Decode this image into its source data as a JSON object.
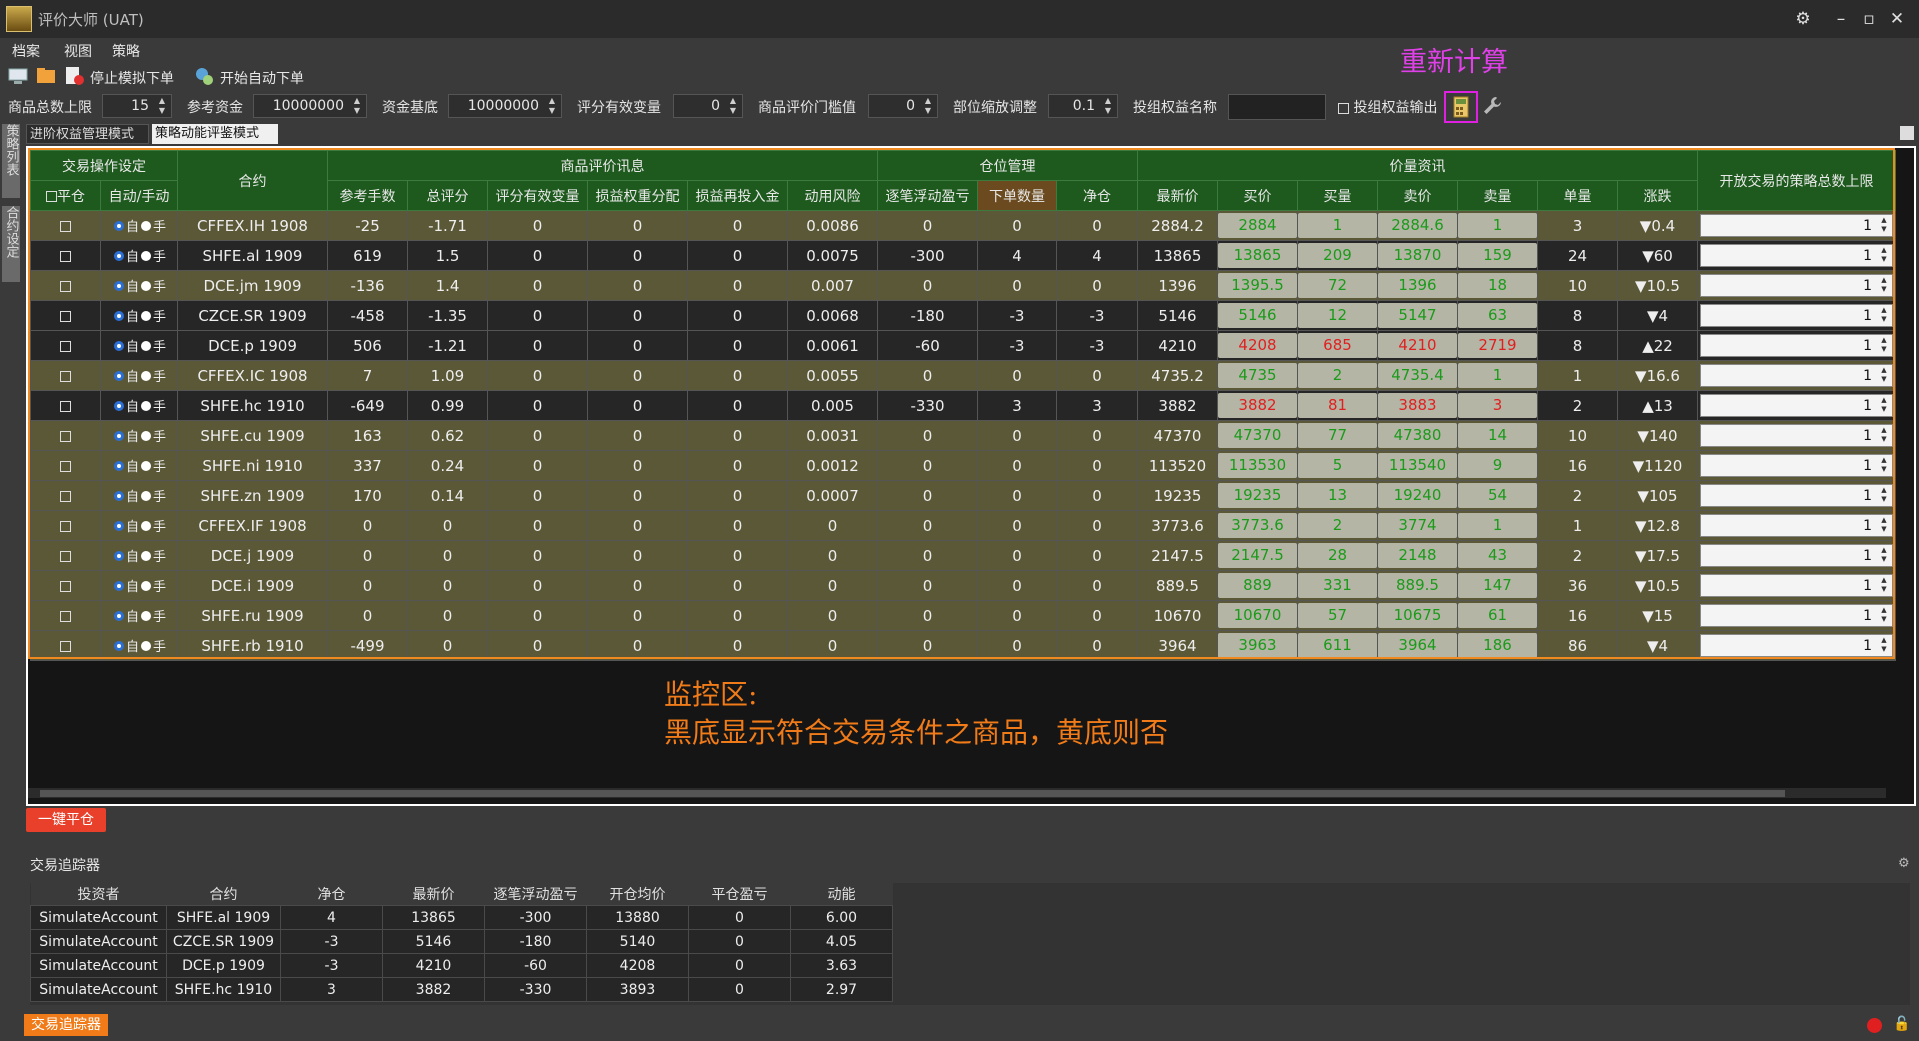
{
  "app": {
    "title": "评价大师 (UAT)"
  },
  "menu": [
    "档案",
    "视图",
    "策略"
  ],
  "toolbar": {
    "stop_sim": "停止模拟下单",
    "start_auto": "开始自动下单",
    "recalc_label": "重新计算"
  },
  "params": [
    {
      "label": "商品总数上限",
      "value": "15"
    },
    {
      "label": "参考资金",
      "value": "10000000"
    },
    {
      "label": "资金基底",
      "value": "10000000"
    },
    {
      "label": "评分有效变量",
      "value": "0"
    },
    {
      "label": "商品评价门槛值",
      "value": "0"
    },
    {
      "label": "部位缩放调整",
      "value": "0.1"
    }
  ],
  "portfolio_name_label": "投组权益名称",
  "portfolio_output_label": "投组权益输出",
  "left_tabs": [
    "策略列表",
    "合约设定"
  ],
  "mode_tabs": [
    "进阶权益管理模式",
    "策略动能评鉴模式"
  ],
  "grid": {
    "groups": [
      "交易操作设定",
      "合约",
      "商品评价讯息",
      "仓位管理",
      "价量资讯",
      "开放交易的策略总数上限"
    ],
    "columns": [
      "平仓",
      "自动/手动",
      "参考手数",
      "总评分",
      "评分有效变量",
      "损益权重分配",
      "损益再投入金",
      "动用风险",
      "逐笔浮动盈亏",
      "下单数量",
      "净仓",
      "最新价",
      "买价",
      "买量",
      "卖价",
      "卖量",
      "单量",
      "涨跌"
    ],
    "radio_labels": [
      "自",
      "手"
    ],
    "rows": [
      {
        "contract": "CFFEX.IH 1908",
        "ref": "-25",
        "score": "-1.71",
        "eff": "0",
        "w": "0",
        "re": "0",
        "risk": "0.0086",
        "float": "0",
        "qty": "0",
        "net": "0",
        "last": "2884.2",
        "bid": "2884",
        "bidv": "1",
        "ask": "2884.6",
        "askv": "1",
        "vol": "3",
        "chg": "▼0.4",
        "up": false,
        "red": false,
        "black": false,
        "limit": "1"
      },
      {
        "contract": "SHFE.al 1909",
        "ref": "619",
        "score": "1.5",
        "eff": "0",
        "w": "0",
        "re": "0",
        "risk": "0.0075",
        "float": "-300",
        "qty": "4",
        "net": "4",
        "last": "13865",
        "bid": "13865",
        "bidv": "209",
        "ask": "13870",
        "askv": "159",
        "vol": "24",
        "chg": "▼60",
        "up": false,
        "red": false,
        "black": true,
        "limit": "1"
      },
      {
        "contract": "DCE.jm 1909",
        "ref": "-136",
        "score": "1.4",
        "eff": "0",
        "w": "0",
        "re": "0",
        "risk": "0.007",
        "float": "0",
        "qty": "0",
        "net": "0",
        "last": "1396",
        "bid": "1395.5",
        "bidv": "72",
        "ask": "1396",
        "askv": "18",
        "vol": "10",
        "chg": "▼10.5",
        "up": false,
        "red": false,
        "black": false,
        "limit": "1"
      },
      {
        "contract": "CZCE.SR 1909",
        "ref": "-458",
        "score": "-1.35",
        "eff": "0",
        "w": "0",
        "re": "0",
        "risk": "0.0068",
        "float": "-180",
        "qty": "-3",
        "net": "-3",
        "last": "5146",
        "bid": "5146",
        "bidv": "12",
        "ask": "5147",
        "askv": "63",
        "vol": "8",
        "chg": "▼4",
        "up": false,
        "red": false,
        "black": true,
        "limit": "1"
      },
      {
        "contract": "DCE.p 1909",
        "ref": "506",
        "score": "-1.21",
        "eff": "0",
        "w": "0",
        "re": "0",
        "risk": "0.0061",
        "float": "-60",
        "qty": "-3",
        "net": "-3",
        "last": "4210",
        "bid": "4208",
        "bidv": "685",
        "ask": "4210",
        "askv": "2719",
        "vol": "8",
        "chg": "▲22",
        "up": true,
        "red": true,
        "black": true,
        "limit": "1"
      },
      {
        "contract": "CFFEX.IC 1908",
        "ref": "7",
        "score": "1.09",
        "eff": "0",
        "w": "0",
        "re": "0",
        "risk": "0.0055",
        "float": "0",
        "qty": "0",
        "net": "0",
        "last": "4735.2",
        "bid": "4735",
        "bidv": "2",
        "ask": "4735.4",
        "askv": "1",
        "vol": "1",
        "chg": "▼16.6",
        "up": false,
        "red": false,
        "black": false,
        "limit": "1"
      },
      {
        "contract": "SHFE.hc 1910",
        "ref": "-649",
        "score": "0.99",
        "eff": "0",
        "w": "0",
        "re": "0",
        "risk": "0.005",
        "float": "-330",
        "qty": "3",
        "net": "3",
        "last": "3882",
        "bid": "3882",
        "bidv": "81",
        "ask": "3883",
        "askv": "3",
        "vol": "2",
        "chg": "▲13",
        "up": true,
        "red": true,
        "black": true,
        "limit": "1"
      },
      {
        "contract": "SHFE.cu 1909",
        "ref": "163",
        "score": "0.62",
        "eff": "0",
        "w": "0",
        "re": "0",
        "risk": "0.0031",
        "float": "0",
        "qty": "0",
        "net": "0",
        "last": "47370",
        "bid": "47370",
        "bidv": "77",
        "ask": "47380",
        "askv": "14",
        "vol": "10",
        "chg": "▼140",
        "up": false,
        "red": false,
        "black": false,
        "limit": "1"
      },
      {
        "contract": "SHFE.ni 1910",
        "ref": "337",
        "score": "0.24",
        "eff": "0",
        "w": "0",
        "re": "0",
        "risk": "0.0012",
        "float": "0",
        "qty": "0",
        "net": "0",
        "last": "113520",
        "bid": "113530",
        "bidv": "5",
        "ask": "113540",
        "askv": "9",
        "vol": "16",
        "chg": "▼1120",
        "up": false,
        "red": false,
        "black": false,
        "limit": "1"
      },
      {
        "contract": "SHFE.zn 1909",
        "ref": "170",
        "score": "0.14",
        "eff": "0",
        "w": "0",
        "re": "0",
        "risk": "0.0007",
        "float": "0",
        "qty": "0",
        "net": "0",
        "last": "19235",
        "bid": "19235",
        "bidv": "13",
        "ask": "19240",
        "askv": "54",
        "vol": "2",
        "chg": "▼105",
        "up": false,
        "red": false,
        "black": false,
        "limit": "1"
      },
      {
        "contract": "CFFEX.IF 1908",
        "ref": "0",
        "score": "0",
        "eff": "0",
        "w": "0",
        "re": "0",
        "risk": "0",
        "float": "0",
        "qty": "0",
        "net": "0",
        "last": "3773.6",
        "bid": "3773.6",
        "bidv": "2",
        "ask": "3774",
        "askv": "1",
        "vol": "1",
        "chg": "▼12.8",
        "up": false,
        "red": false,
        "black": false,
        "limit": "1"
      },
      {
        "contract": "DCE.j 1909",
        "ref": "0",
        "score": "0",
        "eff": "0",
        "w": "0",
        "re": "0",
        "risk": "0",
        "float": "0",
        "qty": "0",
        "net": "0",
        "last": "2147.5",
        "bid": "2147.5",
        "bidv": "28",
        "ask": "2148",
        "askv": "43",
        "vol": "2",
        "chg": "▼17.5",
        "up": false,
        "red": false,
        "black": false,
        "limit": "1"
      },
      {
        "contract": "DCE.i 1909",
        "ref": "0",
        "score": "0",
        "eff": "0",
        "w": "0",
        "re": "0",
        "risk": "0",
        "float": "0",
        "qty": "0",
        "net": "0",
        "last": "889.5",
        "bid": "889",
        "bidv": "331",
        "ask": "889.5",
        "askv": "147",
        "vol": "36",
        "chg": "▼10.5",
        "up": false,
        "red": false,
        "black": false,
        "limit": "1"
      },
      {
        "contract": "SHFE.ru 1909",
        "ref": "0",
        "score": "0",
        "eff": "0",
        "w": "0",
        "re": "0",
        "risk": "0",
        "float": "0",
        "qty": "0",
        "net": "0",
        "last": "10670",
        "bid": "10670",
        "bidv": "57",
        "ask": "10675",
        "askv": "61",
        "vol": "16",
        "chg": "▼15",
        "up": false,
        "red": false,
        "black": false,
        "limit": "1"
      },
      {
        "contract": "SHFE.rb 1910",
        "ref": "-499",
        "score": "0",
        "eff": "0",
        "w": "0",
        "re": "0",
        "risk": "0",
        "float": "0",
        "qty": "0",
        "net": "0",
        "last": "3964",
        "bid": "3963",
        "bidv": "611",
        "ask": "3964",
        "askv": "186",
        "vol": "86",
        "chg": "▼4",
        "up": false,
        "red": false,
        "black": false,
        "limit": "1"
      }
    ]
  },
  "monitor_note": [
    "监控区:",
    "黑底显示符合交易条件之商品，黄底则否"
  ],
  "close_all_label": "一键平仓",
  "tracker": {
    "title": "交易追踪器",
    "headers": [
      "投资者",
      "合约",
      "净仓",
      "最新价",
      "逐笔浮动盈亏",
      "开仓均价",
      "平仓盈亏",
      "动能"
    ],
    "rows": [
      [
        "SimulateAccount",
        "SHFE.al 1909",
        "4",
        "13865",
        "-300",
        "13880",
        "0",
        "6.00"
      ],
      [
        "SimulateAccount",
        "CZCE.SR 1909",
        "-3",
        "5146",
        "-180",
        "5140",
        "0",
        "4.05"
      ],
      [
        "SimulateAccount",
        "DCE.p 1909",
        "-3",
        "4210",
        "-60",
        "4208",
        "0",
        "3.63"
      ],
      [
        "SimulateAccount",
        "SHFE.hc 1910",
        "3",
        "3882",
        "-330",
        "3893",
        "0",
        "2.97"
      ]
    ],
    "tab_label": "交易追踪器"
  },
  "colors": {
    "highlight": "#e020e0",
    "accent": "#f07b18",
    "header_green": "#1e5a1e",
    "up_red": "#ff2a2a",
    "down_green": "#1fa81f"
  }
}
